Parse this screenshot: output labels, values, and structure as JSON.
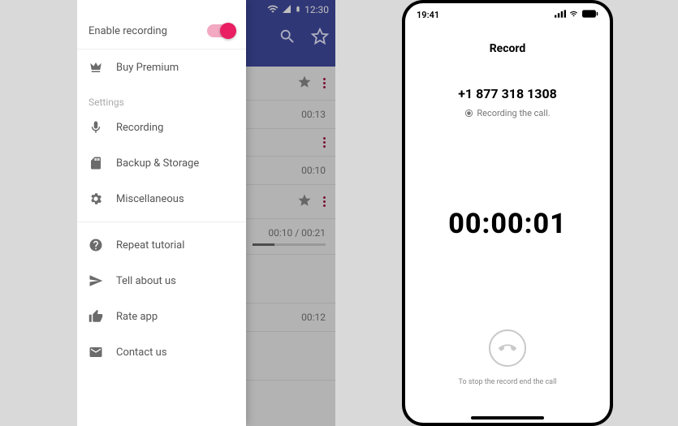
{
  "android": {
    "status_time": "12:30",
    "header_actions": [
      "search",
      "favorite"
    ],
    "drawer": {
      "enable_recording_label": "Enable recording",
      "enable_recording_on": true,
      "buy_premium_label": "Buy Premium",
      "settings_section": "Settings",
      "items_settings": [
        {
          "icon": "mic-icon",
          "label": "Recording"
        },
        {
          "icon": "sd-card-icon",
          "label": "Backup & Storage"
        },
        {
          "icon": "gear-icon",
          "label": "Miscellaneous"
        }
      ],
      "items_about": [
        {
          "icon": "help-icon",
          "label": "Repeat tutorial"
        },
        {
          "icon": "send-icon",
          "label": "Tell about us"
        },
        {
          "icon": "thumb-up-icon",
          "label": "Rate app"
        },
        {
          "icon": "mail-icon",
          "label": "Contact us"
        }
      ]
    },
    "behind_rows": [
      {
        "star": true,
        "time": "00:13"
      },
      {
        "star": false,
        "time": "00:10"
      },
      {
        "star": true,
        "time": "00:10 / 00:21",
        "progress": true
      },
      {
        "star": false,
        "time": ""
      },
      {
        "star": false,
        "time": "00:12"
      },
      {
        "star": false,
        "time": ""
      }
    ]
  },
  "ios": {
    "status_time": "19:41",
    "title": "Record",
    "phone_number": "+1 877 318 1308",
    "recording_label": "Recording the call.",
    "timer": "00:00:01",
    "hint": "To stop the record end the call"
  },
  "colors": {
    "accent": "#e91e63",
    "header": "#3f4a9e",
    "fab": "#a6184a"
  }
}
